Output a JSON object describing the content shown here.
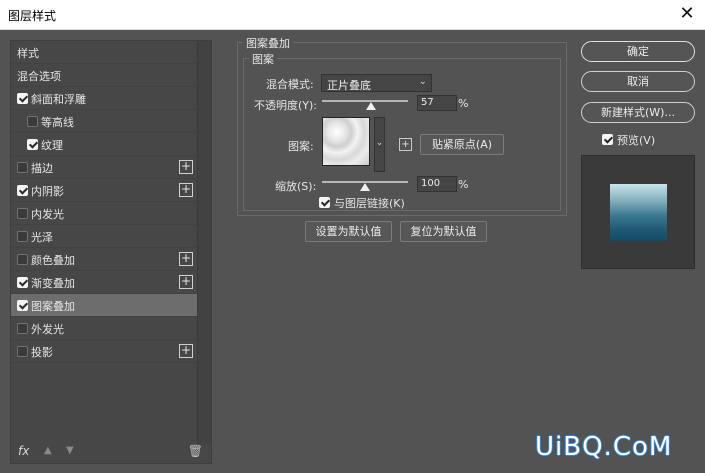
{
  "window": {
    "title": "图层样式"
  },
  "sidebar": {
    "items": [
      {
        "label": "样式",
        "checkbox": false,
        "checked": false,
        "plus": false,
        "indent": false
      },
      {
        "label": "混合选项",
        "checkbox": false,
        "checked": false,
        "plus": false,
        "indent": false
      },
      {
        "label": "斜面和浮雕",
        "checkbox": true,
        "checked": true,
        "plus": false,
        "indent": false
      },
      {
        "label": "等高线",
        "checkbox": true,
        "checked": false,
        "plus": false,
        "indent": true
      },
      {
        "label": "纹理",
        "checkbox": true,
        "checked": true,
        "plus": false,
        "indent": true
      },
      {
        "label": "描边",
        "checkbox": true,
        "checked": false,
        "plus": true,
        "indent": false
      },
      {
        "label": "内阴影",
        "checkbox": true,
        "checked": true,
        "plus": true,
        "indent": false
      },
      {
        "label": "内发光",
        "checkbox": true,
        "checked": false,
        "plus": false,
        "indent": false
      },
      {
        "label": "光泽",
        "checkbox": true,
        "checked": false,
        "plus": false,
        "indent": false
      },
      {
        "label": "颜色叠加",
        "checkbox": true,
        "checked": false,
        "plus": true,
        "indent": false
      },
      {
        "label": "渐变叠加",
        "checkbox": true,
        "checked": true,
        "plus": true,
        "indent": false
      },
      {
        "label": "图案叠加",
        "checkbox": true,
        "checked": true,
        "plus": false,
        "indent": false,
        "active": true
      },
      {
        "label": "外发光",
        "checkbox": true,
        "checked": false,
        "plus": false,
        "indent": false
      },
      {
        "label": "投影",
        "checkbox": true,
        "checked": false,
        "plus": true,
        "indent": false
      }
    ],
    "bottom": {
      "fx": "fx",
      "up_icon": "arrow-up-icon",
      "down_icon": "arrow-down-icon",
      "trash_icon": "trash-icon"
    }
  },
  "panel": {
    "section_title": "图案叠加",
    "group_title": "图案",
    "blend_mode_label": "混合模式:",
    "blend_mode_value": "正片叠底",
    "opacity_label": "不透明度(Y):",
    "opacity_value": "57",
    "opacity_unit": "%",
    "pattern_label": "图案:",
    "snap_origin_button": "贴紧原点(A)",
    "scale_label": "缩放(S):",
    "scale_value": "100",
    "scale_unit": "%",
    "link_label": "与图层链接(K)",
    "link_checked": true,
    "set_default_button": "设置为默认值",
    "reset_default_button": "复位为默认值"
  },
  "right": {
    "ok_button": "确定",
    "cancel_button": "取消",
    "new_style_button": "新建样式(W)...",
    "preview_label": "预览(V)",
    "preview_checked": true
  },
  "watermark": "UiBQ.CoM",
  "colors": {
    "dialog_bg": "#535353",
    "active_item": "#6d6d6d",
    "preview_water": "#1f5a74"
  }
}
